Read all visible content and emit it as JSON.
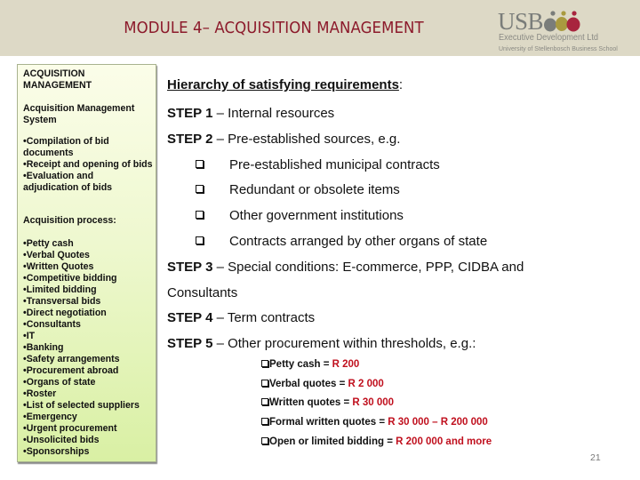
{
  "header": {
    "title": "MODULE 4– ACQUISITION MANAGEMENT",
    "background_color": "#ddd9c6",
    "title_color": "#8c1a2b",
    "logo": {
      "name": "USB",
      "line1": "Executive Development Ltd",
      "line2": "University of Stellenbosch Business School",
      "figure_colors": [
        "#7a7d7a",
        "#a99a3f",
        "#a8253e"
      ]
    }
  },
  "sidebar": {
    "title": "ACQUISITION MANAGEMENT",
    "system_heading": "Acquisition Management System",
    "system_items": [
      "•Compilation of bid documents",
      "•Receipt and opening of bids",
      "•Evaluation and adjudication of bids"
    ],
    "process_heading": "Acquisition process:",
    "process_items": [
      "•Petty cash",
      "•Verbal Quotes",
      "•Written Quotes",
      "•Competitive bidding",
      "•Limited bidding",
      "•Transversal bids",
      "•Direct negotiation",
      "•Consultants",
      "•IT",
      "•Banking",
      "•Safety arrangements",
      "•Procurement abroad",
      "•Organs of state",
      "•Roster",
      "•List of selected suppliers",
      "•Emergency",
      "•Urgent procurement",
      "•Unsolicited bids",
      "•Sponsorships"
    ]
  },
  "main": {
    "heading": "Hierarchy of satisfying requirements",
    "heading_suffix": ":",
    "steps": [
      {
        "label": "STEP 1",
        "text": " – Internal resources"
      },
      {
        "label": "STEP 2",
        "text": " – Pre-established sources, e.g."
      },
      {
        "label": "STEP 3",
        "text": " – Special conditions: E-commerce, PPP, CIDBA and",
        "continuation": "Consultants"
      },
      {
        "label": "STEP 4",
        "text": " – Term contracts"
      },
      {
        "label": "STEP 5",
        "text": " – Other procurement within thresholds, e.g.:"
      }
    ],
    "step2_items": [
      "Pre-established municipal contracts",
      "Redundant or obsolete items",
      "Other government institutions",
      "Contracts arranged by other organs of state"
    ],
    "thresholds": [
      {
        "label": "Petty cash = ",
        "amount": "R 200"
      },
      {
        "label": "Verbal quotes = ",
        "amount": "R 2 000"
      },
      {
        "label": "Written quotes = ",
        "amount": "R 30 000"
      },
      {
        "label": "Formal written quotes = ",
        "amount": "R 30 000 – R 200 000"
      },
      {
        "label": "Open or limited bidding = ",
        "amount": "R 200 000 and more"
      }
    ],
    "amount_color": "#c0101e"
  },
  "footer": {
    "page_number": "21"
  }
}
